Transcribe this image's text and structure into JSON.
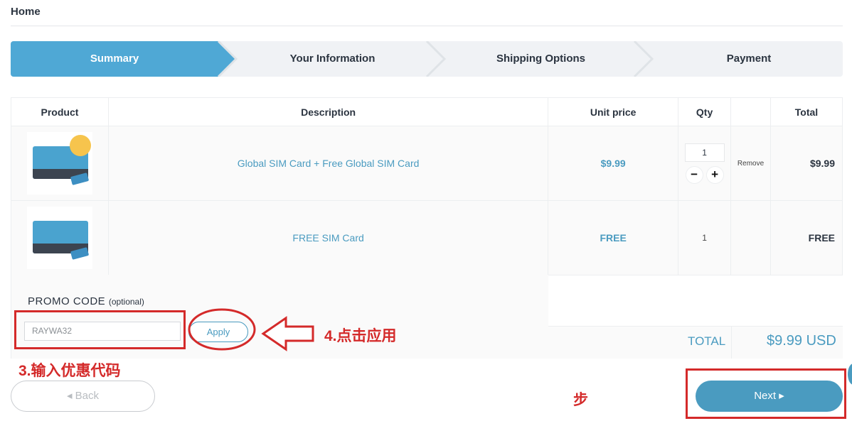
{
  "nav": {
    "home": "Home"
  },
  "steps": [
    {
      "label": "Summary",
      "active": true
    },
    {
      "label": "Your Information",
      "active": false
    },
    {
      "label": "Shipping Options",
      "active": false
    },
    {
      "label": "Payment",
      "active": false
    }
  ],
  "table": {
    "headers": {
      "product": "Product",
      "description": "Description",
      "unit_price": "Unit price",
      "qty": "Qty",
      "total": "Total"
    },
    "rows": [
      {
        "description": "Global SIM Card + Free Global SIM Card",
        "unit_price": "$9.99",
        "qty": "1",
        "remove": "Remove",
        "total": "$9.99",
        "qty_minus": "−",
        "qty_plus": "+"
      },
      {
        "description": "FREE SIM Card",
        "unit_price": "FREE",
        "qty": "1",
        "total": "FREE"
      }
    ]
  },
  "promo": {
    "title": "PROMO CODE",
    "optional": "(optional)",
    "value": "RAYWA32",
    "apply": "Apply"
  },
  "summary": {
    "total_label": "TOTAL",
    "total_value": "$9.99 USD"
  },
  "footer": {
    "back": "◂ Back",
    "next": "Next ▸"
  },
  "annotations": {
    "step3": "3.输入优惠代码",
    "step4": "4.点击应用",
    "stray": "步"
  },
  "colors": {
    "accent": "#4a9bc0",
    "annotation": "#d42a2a"
  },
  "icons": {
    "minus": "minus-icon",
    "plus": "plus-icon",
    "back": "caret-left-icon",
    "next": "caret-right-icon"
  }
}
